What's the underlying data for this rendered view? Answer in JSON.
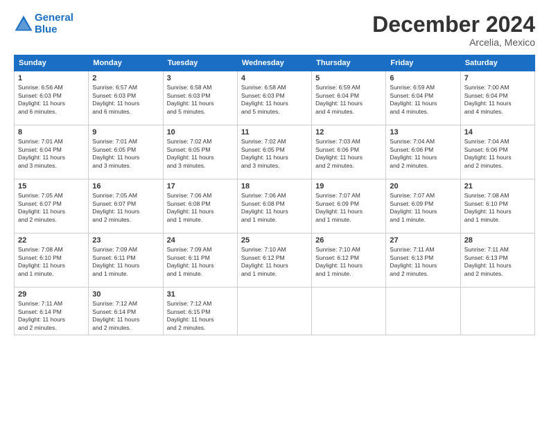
{
  "header": {
    "logo_line1": "General",
    "logo_line2": "Blue",
    "month_title": "December 2024",
    "location": "Arcelia, Mexico"
  },
  "weekdays": [
    "Sunday",
    "Monday",
    "Tuesday",
    "Wednesday",
    "Thursday",
    "Friday",
    "Saturday"
  ],
  "weeks": [
    [
      {
        "day": "1",
        "info": "Sunrise: 6:56 AM\nSunset: 6:03 PM\nDaylight: 11 hours\nand 6 minutes."
      },
      {
        "day": "2",
        "info": "Sunrise: 6:57 AM\nSunset: 6:03 PM\nDaylight: 11 hours\nand 6 minutes."
      },
      {
        "day": "3",
        "info": "Sunrise: 6:58 AM\nSunset: 6:03 PM\nDaylight: 11 hours\nand 5 minutes."
      },
      {
        "day": "4",
        "info": "Sunrise: 6:58 AM\nSunset: 6:03 PM\nDaylight: 11 hours\nand 5 minutes."
      },
      {
        "day": "5",
        "info": "Sunrise: 6:59 AM\nSunset: 6:04 PM\nDaylight: 11 hours\nand 4 minutes."
      },
      {
        "day": "6",
        "info": "Sunrise: 6:59 AM\nSunset: 6:04 PM\nDaylight: 11 hours\nand 4 minutes."
      },
      {
        "day": "7",
        "info": "Sunrise: 7:00 AM\nSunset: 6:04 PM\nDaylight: 11 hours\nand 4 minutes."
      }
    ],
    [
      {
        "day": "8",
        "info": "Sunrise: 7:01 AM\nSunset: 6:04 PM\nDaylight: 11 hours\nand 3 minutes."
      },
      {
        "day": "9",
        "info": "Sunrise: 7:01 AM\nSunset: 6:05 PM\nDaylight: 11 hours\nand 3 minutes."
      },
      {
        "day": "10",
        "info": "Sunrise: 7:02 AM\nSunset: 6:05 PM\nDaylight: 11 hours\nand 3 minutes."
      },
      {
        "day": "11",
        "info": "Sunrise: 7:02 AM\nSunset: 6:05 PM\nDaylight: 11 hours\nand 3 minutes."
      },
      {
        "day": "12",
        "info": "Sunrise: 7:03 AM\nSunset: 6:06 PM\nDaylight: 11 hours\nand 2 minutes."
      },
      {
        "day": "13",
        "info": "Sunrise: 7:04 AM\nSunset: 6:06 PM\nDaylight: 11 hours\nand 2 minutes."
      },
      {
        "day": "14",
        "info": "Sunrise: 7:04 AM\nSunset: 6:06 PM\nDaylight: 11 hours\nand 2 minutes."
      }
    ],
    [
      {
        "day": "15",
        "info": "Sunrise: 7:05 AM\nSunset: 6:07 PM\nDaylight: 11 hours\nand 2 minutes."
      },
      {
        "day": "16",
        "info": "Sunrise: 7:05 AM\nSunset: 6:07 PM\nDaylight: 11 hours\nand 2 minutes."
      },
      {
        "day": "17",
        "info": "Sunrise: 7:06 AM\nSunset: 6:08 PM\nDaylight: 11 hours\nand 1 minute."
      },
      {
        "day": "18",
        "info": "Sunrise: 7:06 AM\nSunset: 6:08 PM\nDaylight: 11 hours\nand 1 minute."
      },
      {
        "day": "19",
        "info": "Sunrise: 7:07 AM\nSunset: 6:09 PM\nDaylight: 11 hours\nand 1 minute."
      },
      {
        "day": "20",
        "info": "Sunrise: 7:07 AM\nSunset: 6:09 PM\nDaylight: 11 hours\nand 1 minute."
      },
      {
        "day": "21",
        "info": "Sunrise: 7:08 AM\nSunset: 6:10 PM\nDaylight: 11 hours\nand 1 minute."
      }
    ],
    [
      {
        "day": "22",
        "info": "Sunrise: 7:08 AM\nSunset: 6:10 PM\nDaylight: 11 hours\nand 1 minute."
      },
      {
        "day": "23",
        "info": "Sunrise: 7:09 AM\nSunset: 6:11 PM\nDaylight: 11 hours\nand 1 minute."
      },
      {
        "day": "24",
        "info": "Sunrise: 7:09 AM\nSunset: 6:11 PM\nDaylight: 11 hours\nand 1 minute."
      },
      {
        "day": "25",
        "info": "Sunrise: 7:10 AM\nSunset: 6:12 PM\nDaylight: 11 hours\nand 1 minute."
      },
      {
        "day": "26",
        "info": "Sunrise: 7:10 AM\nSunset: 6:12 PM\nDaylight: 11 hours\nand 1 minute."
      },
      {
        "day": "27",
        "info": "Sunrise: 7:11 AM\nSunset: 6:13 PM\nDaylight: 11 hours\nand 2 minutes."
      },
      {
        "day": "28",
        "info": "Sunrise: 7:11 AM\nSunset: 6:13 PM\nDaylight: 11 hours\nand 2 minutes."
      }
    ],
    [
      {
        "day": "29",
        "info": "Sunrise: 7:11 AM\nSunset: 6:14 PM\nDaylight: 11 hours\nand 2 minutes."
      },
      {
        "day": "30",
        "info": "Sunrise: 7:12 AM\nSunset: 6:14 PM\nDaylight: 11 hours\nand 2 minutes."
      },
      {
        "day": "31",
        "info": "Sunrise: 7:12 AM\nSunset: 6:15 PM\nDaylight: 11 hours\nand 2 minutes."
      },
      {
        "day": "",
        "info": ""
      },
      {
        "day": "",
        "info": ""
      },
      {
        "day": "",
        "info": ""
      },
      {
        "day": "",
        "info": ""
      }
    ]
  ]
}
